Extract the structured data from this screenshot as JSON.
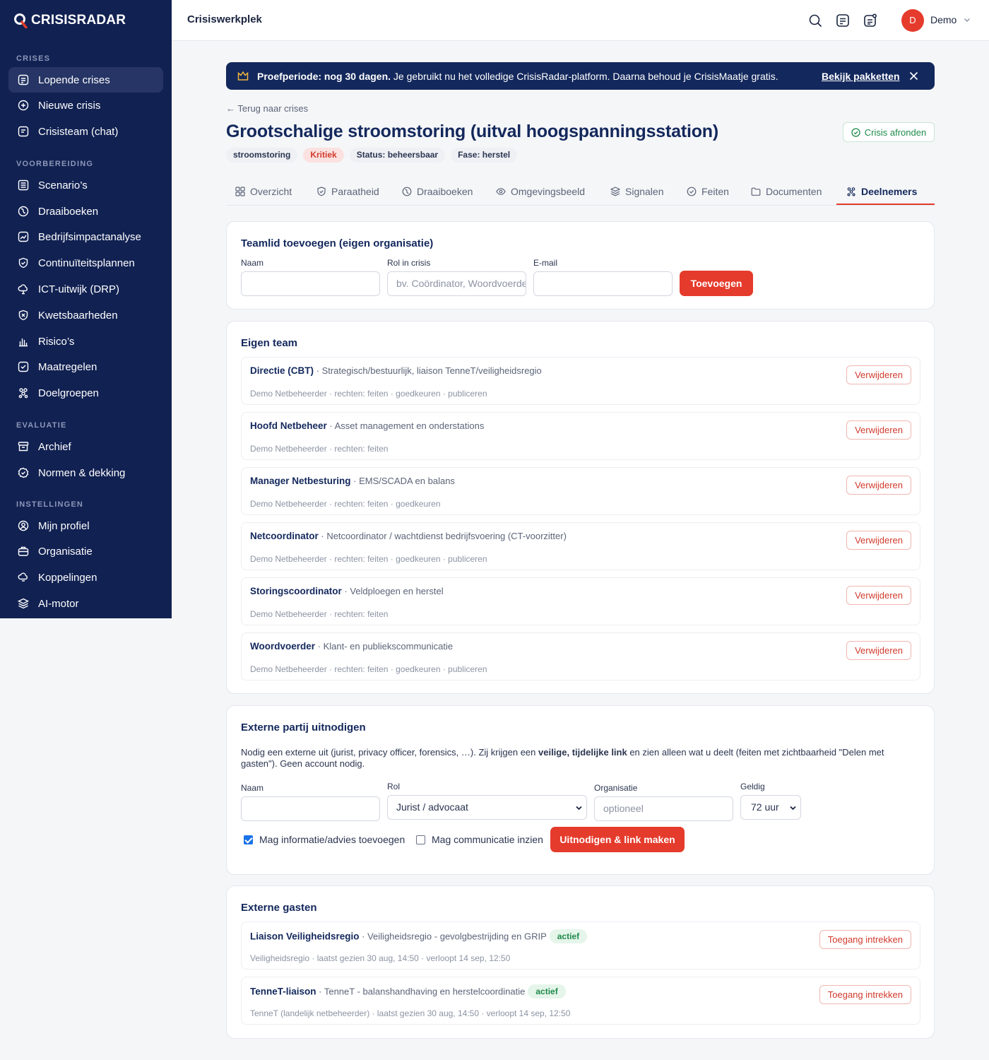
{
  "brand": {
    "name": "CRISISRADAR"
  },
  "sidebar": {
    "sections": [
      {
        "title": "CRISES",
        "items": [
          {
            "label": "Lopende crises",
            "icon": "list-icon",
            "active": true
          },
          {
            "label": "Nieuwe crisis",
            "icon": "plus-circle-icon"
          },
          {
            "label": "Crisisteam (chat)",
            "icon": "chat-icon"
          }
        ]
      },
      {
        "title": "VOORBEREIDING",
        "items": [
          {
            "label": "Scenario’s",
            "icon": "document-icon"
          },
          {
            "label": "Draaiboeken",
            "icon": "book-icon"
          },
          {
            "label": "Bedrijfsimpactanalyse",
            "icon": "chart-icon"
          },
          {
            "label": "Continuïteitsplannen",
            "icon": "shield-icon"
          },
          {
            "label": "ICT-uitwijk (DRP)",
            "icon": "cloud-icon"
          },
          {
            "label": "Kwetsbaarheden",
            "icon": "shield-x-icon"
          },
          {
            "label": "Risico’s",
            "icon": "bar-chart-icon"
          },
          {
            "label": "Maatregelen",
            "icon": "check-square-icon"
          },
          {
            "label": "Doelgroepen",
            "icon": "users-icon"
          }
        ]
      },
      {
        "title": "EVALUATIE",
        "items": [
          {
            "label": "Archief",
            "icon": "archive-icon"
          },
          {
            "label": "Normen & dekking",
            "icon": "badge-check-icon"
          }
        ]
      },
      {
        "title": "INSTELLINGEN",
        "items": [
          {
            "label": "Mijn profiel",
            "icon": "user-circle-icon"
          },
          {
            "label": "Organisatie",
            "icon": "briefcase-icon"
          },
          {
            "label": "Koppelingen",
            "icon": "cloud-link-icon"
          },
          {
            "label": "AI-motor",
            "icon": "layers-icon"
          }
        ]
      }
    ]
  },
  "topbar": {
    "title": "Crisiswerkplek",
    "user_initial": "D",
    "user_name": "Demo"
  },
  "banner": {
    "bold": "Proefperiode: nog 30 dagen.",
    "text": " Je gebruikt nu het volledige CrisisRadar-platform. Daarna behoud je CrisisMaatje gratis.",
    "link": "Bekijk pakketten"
  },
  "page": {
    "back": "Terug naar crises",
    "title": "Grootschalige stroomstoring (uitval hoogspanningsstation)",
    "finish": "Crisis afronden",
    "tags": [
      {
        "label": "stroomstoring",
        "kind": "neutral"
      },
      {
        "label": "Kritiek",
        "kind": "critical"
      },
      {
        "label": "Status: beheersbaar",
        "kind": "neutral"
      },
      {
        "label": "Fase: herstel",
        "kind": "neutral"
      }
    ]
  },
  "tabs": [
    {
      "label": "Overzicht",
      "icon": "grid-icon"
    },
    {
      "label": "Paraatheid",
      "icon": "shield-check-icon"
    },
    {
      "label": "Draaiboeken",
      "icon": "book-icon"
    },
    {
      "label": "Omgevingsbeeld",
      "icon": "eye-icon"
    },
    {
      "label": "Signalen",
      "icon": "layers-icon"
    },
    {
      "label": "Feiten",
      "icon": "check-circle-icon"
    },
    {
      "label": "Documenten",
      "icon": "folder-icon"
    },
    {
      "label": "Deelnemers",
      "icon": "users-icon",
      "active": true
    }
  ],
  "add_member": {
    "title": "Teamlid toevoegen (eigen organisatie)",
    "name_label": "Naam",
    "name_value": "",
    "role_label": "Rol in crisis",
    "role_placeholder": "bv. Coördinator, Woordvoerder",
    "email_label": "E-mail",
    "email_value": "",
    "button": "Toevoegen"
  },
  "own_team": {
    "title": "Eigen team",
    "remove_label": "Verwijderen",
    "members": [
      {
        "name": "Directie (CBT)",
        "role": " · Strategisch/bestuurlijk, liaison TenneT/veiligheidsregio",
        "meta": "Demo Netbeheerder · rechten: feiten · goedkeuren · publiceren"
      },
      {
        "name": "Hoofd Netbeheer",
        "role": " · Asset management en onderstations",
        "meta": "Demo Netbeheerder · rechten: feiten"
      },
      {
        "name": "Manager Netbesturing",
        "role": " · EMS/SCADA en balans",
        "meta": "Demo Netbeheerder · rechten: feiten · goedkeuren"
      },
      {
        "name": "Netcoordinator",
        "role": " · Netcoordinator / wachtdienst bedrijfsvoering (CT-voorzitter)",
        "meta": "Demo Netbeheerder · rechten: feiten · goedkeuren · publiceren"
      },
      {
        "name": "Storingscoordinator",
        "role": " · Veldploegen en herstel",
        "meta": "Demo Netbeheerder · rechten: feiten"
      },
      {
        "name": "Woordvoerder",
        "role": " · Klant- en publiekscommunicatie",
        "meta": "Demo Netbeheerder · rechten: feiten · goedkeuren · publiceren"
      }
    ]
  },
  "invite": {
    "title": "Externe partij uitnodigen",
    "desc_1": "Nodig een externe uit (jurist, privacy officer, forensics, …). Zij krijgen een ",
    "desc_bold": "veilige, tijdelijke link",
    "desc_2": " en zien alleen wat u deelt (feiten met zichtbaarheid \"Delen met gasten\"). Geen account nodig.",
    "name_label": "Naam",
    "name_value": "",
    "role_label": "Rol",
    "role_value": "Jurist / advocaat",
    "org_label": "Organisatie",
    "org_placeholder": "optioneel",
    "valid_label": "Geldig",
    "valid_value": "72 uur",
    "check_1": "Mag informatie/advies toevoegen",
    "check_1_on": true,
    "check_2": "Mag communicatie inzien",
    "check_2_on": false,
    "button": "Uitnodigen & link maken"
  },
  "guests": {
    "title": "Externe gasten",
    "revoke_label": "Toegang intrekken",
    "items": [
      {
        "name": "Liaison Veiligheidsregio",
        "role": " · Veiligheidsregio - gevolgbestrijding en GRIP",
        "status": "actief",
        "meta": "Veiligheidsregio · laatst gezien 30 aug, 14:50 · verloopt 14 sep, 12:50"
      },
      {
        "name": "TenneT-liaison",
        "role": " · TenneT - balanshandhaving en herstelcoordinatie",
        "status": "actief",
        "meta": "TenneT (landelijk netbeheerder) · laatst gezien 30 aug, 14:50 · verloopt 14 sep, 12:50"
      }
    ]
  },
  "colors": {
    "sidebar": "#112152",
    "accent": "#e53b2c",
    "navy": "#13285c",
    "success": "#1f8a4b"
  }
}
